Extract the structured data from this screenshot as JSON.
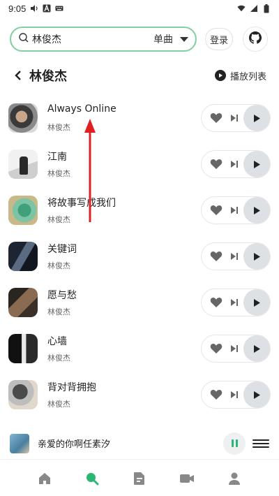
{
  "status_bar": {
    "time": "9:05"
  },
  "search": {
    "query": "林俊杰",
    "type_label": "单曲"
  },
  "header_buttons": {
    "login_label": "登录"
  },
  "header": {
    "artist_title": "林俊杰",
    "playlist_label": "播放列表"
  },
  "songs": [
    {
      "title": "Always Online",
      "artist": "林俊杰"
    },
    {
      "title": "江南",
      "artist": "林俊杰"
    },
    {
      "title": "将故事写成我们",
      "artist": "林俊杰"
    },
    {
      "title": "关键词",
      "artist": "林俊杰"
    },
    {
      "title": "愿与愁",
      "artist": "林俊杰"
    },
    {
      "title": "心墙",
      "artist": "林俊杰"
    },
    {
      "title": "背对背拥抱",
      "artist": "林俊杰"
    }
  ],
  "now_playing": {
    "title": "亲爱的你啊任素汐",
    "state": "playing"
  },
  "bottom_nav": [
    "home-icon",
    "search-icon",
    "document-icon",
    "video-icon",
    "user-icon"
  ],
  "colors": {
    "accent": "#2bb673",
    "search_border": "#7fcfa2",
    "annotation": "#e02020"
  }
}
